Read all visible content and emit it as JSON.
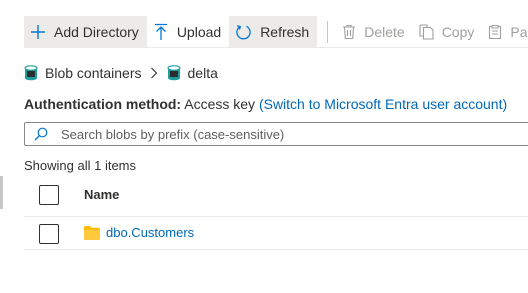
{
  "toolbar": {
    "add_directory": "Add Directory",
    "upload": "Upload",
    "refresh": "Refresh",
    "delete": "Delete",
    "copy": "Copy",
    "paste": "Paste"
  },
  "breadcrumb": {
    "root": "Blob containers",
    "current": "delta"
  },
  "auth": {
    "label": "Authentication method:",
    "value": "Access key",
    "link": "(Switch to Microsoft Entra user account)"
  },
  "search": {
    "placeholder": "Search blobs by prefix (case-sensitive)"
  },
  "status": {
    "count_text": "Showing all 1 items"
  },
  "table": {
    "columns": [
      "Name"
    ],
    "rows": [
      {
        "name": "dbo.Customers",
        "type": "folder"
      }
    ]
  },
  "colors": {
    "accent": "#0067b8",
    "folder": "#ffb900",
    "container_icon": "#1e9e9e"
  },
  "icons": [
    "plus-icon",
    "upload-icon",
    "refresh-icon",
    "delete-icon",
    "copy-icon",
    "paste-icon",
    "container-icon",
    "chevron-right-icon",
    "search-icon",
    "folder-icon"
  ]
}
